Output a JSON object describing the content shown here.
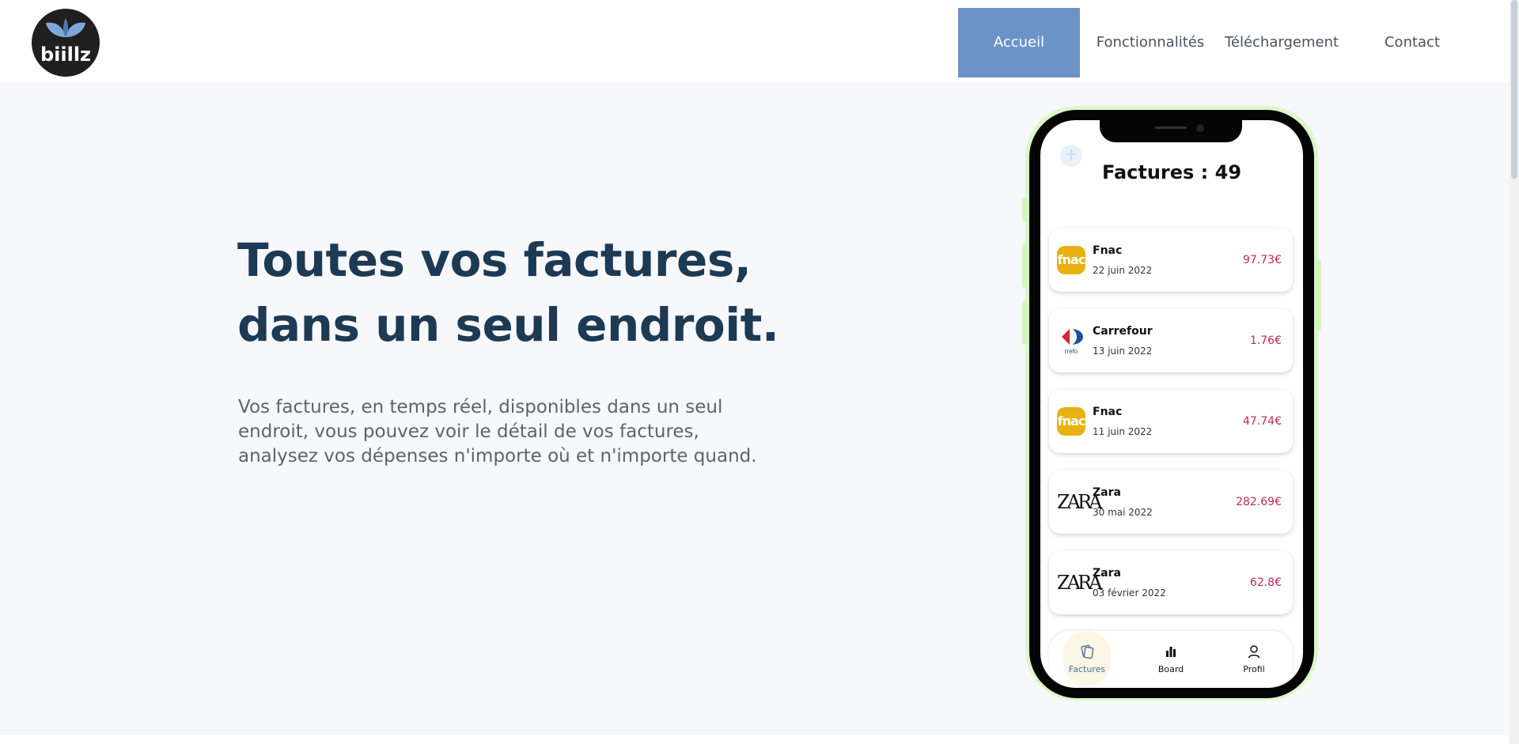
{
  "brand": {
    "logo_text": "biillz"
  },
  "nav": [
    {
      "label": "Accueil",
      "active": true
    },
    {
      "label": "Fonctionnalités",
      "active": false
    },
    {
      "label": "Téléchargement",
      "active": false
    },
    {
      "label": "Contact",
      "active": false
    }
  ],
  "hero": {
    "title_lines": [
      "Toutes vos factures,",
      "dans un seul endroit."
    ],
    "description_lines": [
      "Vos factures, en temps réel, disponibles dans un seul",
      "endroit, vous pouvez voir le détail de vos factures,",
      "analysez vos dépenses n'importe où et n'importe quand."
    ]
  },
  "app": {
    "title": "Factures : 49",
    "invoices": [
      {
        "merchant": "Fnac",
        "date": "22 juin 2022",
        "amount": "97.73€",
        "logo": "fnac-logo"
      },
      {
        "merchant": "Carrefour",
        "date": "13 juin 2022",
        "amount": "1.76€",
        "logo": "carrefour-logo"
      },
      {
        "merchant": "Fnac",
        "date": "11 juin 2022",
        "amount": "47.74€",
        "logo": "fnac-logo"
      },
      {
        "merchant": "Zara",
        "date": "30 mai 2022",
        "amount": "282.69€",
        "logo": "zara-logo"
      },
      {
        "merchant": "Zara",
        "date": "03 février 2022",
        "amount": "62.8€",
        "logo": "zara-logo"
      }
    ],
    "tabs": [
      {
        "label": "Factures",
        "icon": "invoices-icon",
        "active": true
      },
      {
        "label": "Board",
        "icon": "bar-chart-icon",
        "active": false
      },
      {
        "label": "Profil",
        "icon": "user-icon",
        "active": false
      }
    ]
  },
  "colors": {
    "nav_active_bg": "#6b93c8",
    "hero_bg": "#f7f8fb",
    "title_color": "#1d3a54",
    "amount_color": "#c0285a",
    "fnac_yellow": "#e8b10f",
    "phone_glow": "#dcf8c8"
  }
}
